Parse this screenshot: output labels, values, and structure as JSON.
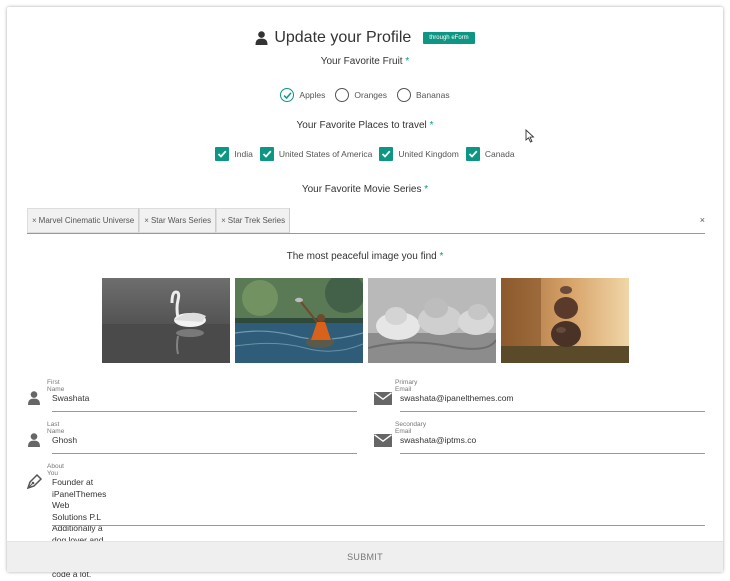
{
  "header": {
    "title": "Update your Profile",
    "badge": "through eForm",
    "icon": "user-icon"
  },
  "fruit": {
    "label": "Your Favorite Fruit",
    "required_mark": "*",
    "options": [
      {
        "label": "Apples",
        "selected": true
      },
      {
        "label": "Oranges",
        "selected": false
      },
      {
        "label": "Bananas",
        "selected": false
      }
    ]
  },
  "places": {
    "label": "Your Favorite Places to travel",
    "required_mark": "*",
    "options": [
      {
        "label": "India",
        "checked": true
      },
      {
        "label": "United States of America",
        "checked": true
      },
      {
        "label": "United Kingdom",
        "checked": true
      },
      {
        "label": "Canada",
        "checked": true
      }
    ]
  },
  "movies": {
    "label": "Your Favorite Movie Series",
    "required_mark": "*",
    "tags": [
      "Marvel Cinematic Universe",
      "Star Wars Series",
      "Star Trek Series"
    ],
    "clear_glyph": "×",
    "tag_remove_glyph": "×"
  },
  "peaceful": {
    "label": "The most peaceful image you find",
    "required_mark": "*",
    "images": [
      "swan",
      "child-meditating-river",
      "sleeping-babies",
      "stacked-stones"
    ]
  },
  "form": {
    "first_name": {
      "label": "First Name",
      "value": "Swashata"
    },
    "last_name": {
      "label": "Last Name",
      "value": "Ghosh"
    },
    "primary_email": {
      "label": "Primary Email",
      "value": "swashata@ipanelthemes.com"
    },
    "secondary_email": {
      "label": "Secondary Email",
      "value": "swashata@iptms.co"
    },
    "about": {
      "label": "About You",
      "lines": [
        "Founder at iPanelThemes Web Solutions P.L",
        "Additionally a dog lover and a biker.",
        "PS: Yes I code a lot."
      ]
    }
  },
  "submit": {
    "label": "SUBMIT"
  },
  "colors": {
    "accent": "#0e9685",
    "submit_bg": "#efefef"
  }
}
